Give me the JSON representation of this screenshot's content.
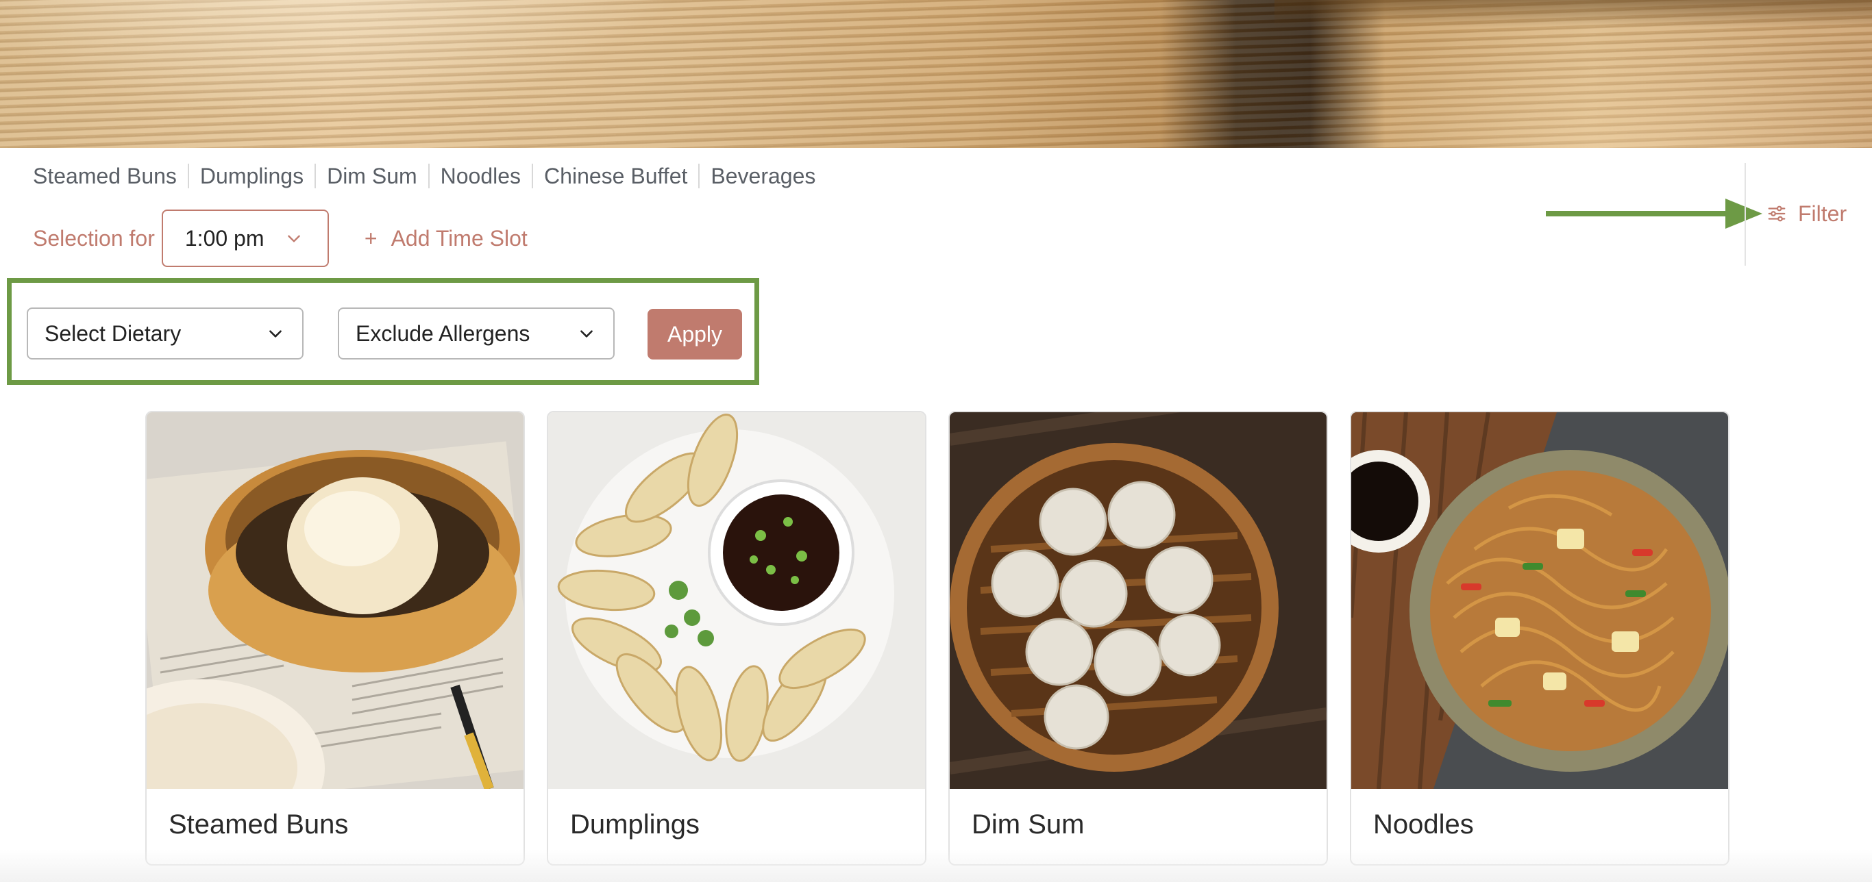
{
  "categories": [
    "Steamed Buns",
    "Dumplings",
    "Dim Sum",
    "Noodles",
    "Chinese Buffet",
    "Beverages"
  ],
  "selection": {
    "label": "Selection for",
    "time_value": "1:00 pm",
    "add_slot_icon": "+",
    "add_slot_label": "Add Time Slot"
  },
  "filters": {
    "dietary_placeholder": "Select Dietary",
    "allergens_placeholder": "Exclude Allergens",
    "apply_label": "Apply"
  },
  "filter_button": {
    "label": "Filter",
    "icon": "sliders-icon"
  },
  "products": [
    {
      "name": "Steamed Buns",
      "image": "steamed-bun-photo"
    },
    {
      "name": "Dumplings",
      "image": "dumplings-photo"
    },
    {
      "name": "Dim Sum",
      "image": "dim-sum-photo"
    },
    {
      "name": "Noodles",
      "image": "noodles-photo"
    }
  ],
  "colors": {
    "accent": "#c07b6e",
    "highlight_green": "#6d9a45",
    "tab_text": "#5a5f66",
    "border": "#b8b8b8"
  }
}
